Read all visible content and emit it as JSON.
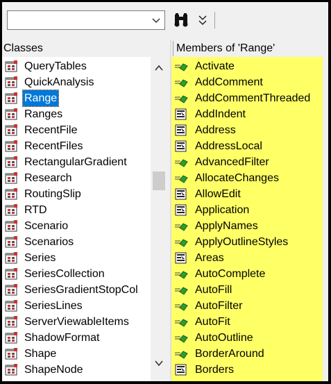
{
  "toolbar": {
    "search_value": "",
    "find_icon": "binoculars-icon",
    "toggle_icon": "double-chevron-icon"
  },
  "classes_header": "Classes",
  "members_header": "Members of 'Range'",
  "classes": [
    "QueryTables",
    "QuickAnalysis",
    "Range",
    "Ranges",
    "RecentFile",
    "RecentFiles",
    "RectangularGradient",
    "Research",
    "RoutingSlip",
    "RTD",
    "Scenario",
    "Scenarios",
    "Series",
    "SeriesCollection",
    "SeriesGradientStopCol",
    "SeriesLines",
    "ServerViewableItems",
    "ShadowFormat",
    "Shape",
    "ShapeNode"
  ],
  "selected_class": "Range",
  "members": [
    {
      "name": "Activate",
      "kind": "method"
    },
    {
      "name": "AddComment",
      "kind": "method"
    },
    {
      "name": "AddCommentThreaded",
      "kind": "method"
    },
    {
      "name": "AddIndent",
      "kind": "property"
    },
    {
      "name": "Address",
      "kind": "property"
    },
    {
      "name": "AddressLocal",
      "kind": "property"
    },
    {
      "name": "AdvancedFilter",
      "kind": "method"
    },
    {
      "name": "AllocateChanges",
      "kind": "method"
    },
    {
      "name": "AllowEdit",
      "kind": "property"
    },
    {
      "name": "Application",
      "kind": "property"
    },
    {
      "name": "ApplyNames",
      "kind": "method"
    },
    {
      "name": "ApplyOutlineStyles",
      "kind": "method"
    },
    {
      "name": "Areas",
      "kind": "property"
    },
    {
      "name": "AutoComplete",
      "kind": "method"
    },
    {
      "name": "AutoFill",
      "kind": "method"
    },
    {
      "name": "AutoFilter",
      "kind": "method"
    },
    {
      "name": "AutoFit",
      "kind": "method"
    },
    {
      "name": "AutoOutline",
      "kind": "method"
    },
    {
      "name": "BorderAround",
      "kind": "method"
    },
    {
      "name": "Borders",
      "kind": "property"
    }
  ],
  "colors": {
    "highlight": "#ffff66",
    "selection": "#0078d7"
  }
}
